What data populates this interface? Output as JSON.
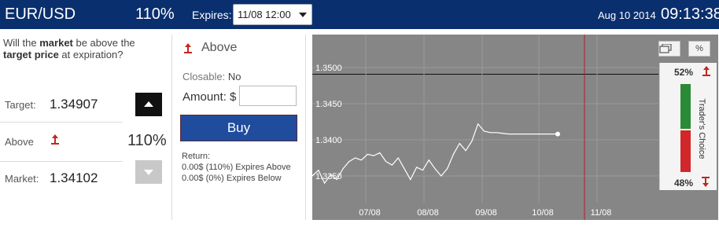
{
  "header": {
    "pair": "EUR/USD",
    "payout": "110%",
    "expires_label": "Expires:",
    "expires_value": "11/08 12:00",
    "date": "Aug 10 2014",
    "time": "09:13:38"
  },
  "left": {
    "question_parts": [
      "Will the ",
      "market",
      " be above the ",
      "target price",
      " at expiration?"
    ],
    "target_label": "Target:",
    "target_value": "1.34907",
    "direction_label": "Above",
    "direction_payout": "110%",
    "market_label": "Market:",
    "market_value": "1.34102"
  },
  "middle": {
    "direction": "Above",
    "closable_label": "Closable:",
    "closable_value": "No",
    "amount_label": "Amount: $",
    "amount_value": "",
    "buy_label": "Buy",
    "return_label": "Return:",
    "return_above": "0.00$ (110%) Expires Above",
    "return_below": "0.00$ (0%) Expires Below"
  },
  "chart_data": {
    "type": "line",
    "x_ticks": [
      "07/08",
      "08/08",
      "09/08",
      "10/08",
      "11/08"
    ],
    "y_ticks": [
      "1.3500",
      "1.3450",
      "1.3400",
      "1.3350"
    ],
    "target_level": 1.34907,
    "current_value": 1.34102,
    "series": [
      {
        "values": [
          1.335,
          1.3358,
          1.334,
          1.3352,
          1.3345,
          1.336,
          1.337,
          1.3375,
          1.3372,
          1.338,
          1.3378,
          1.3382,
          1.337,
          1.3365,
          1.3375,
          1.336,
          1.3345,
          1.3362,
          1.3358,
          1.3372,
          1.336,
          1.335,
          1.336,
          1.338,
          1.3395,
          1.3385,
          1.3398,
          1.3422,
          1.3412,
          1.341,
          1.341,
          1.3409,
          1.3408,
          1.3408,
          1.3408,
          1.3408,
          1.3408,
          1.3408,
          1.3408,
          1.3408,
          1.3408
        ]
      }
    ],
    "colors": {
      "background": "#868686",
      "line": "#ffffff",
      "expiry_line": "#b01e28",
      "target_line": "#111111"
    }
  },
  "trader_choice": {
    "label": "Trader's Choice",
    "up_pct": "52%",
    "down_pct": "48%"
  },
  "colors": {
    "header_bg": "#0a2f6e",
    "buy_bg": "#1f4c9c",
    "accent_red": "#c0281e",
    "green": "#2a8a35"
  }
}
